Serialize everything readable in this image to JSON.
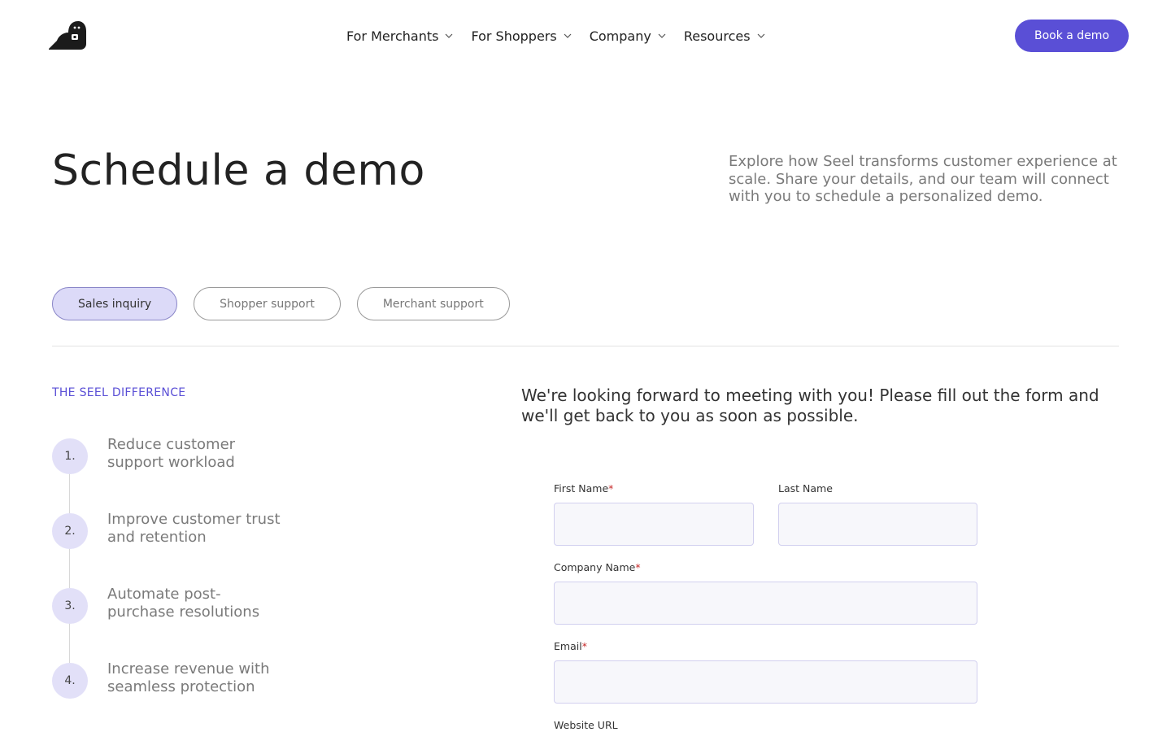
{
  "header": {
    "nav": [
      {
        "label": "For Merchants"
      },
      {
        "label": "For Shoppers"
      },
      {
        "label": "Company"
      },
      {
        "label": "Resources"
      }
    ],
    "cta_label": "Book a demo"
  },
  "hero": {
    "title": "Schedule a demo",
    "description": "Explore how Seel transforms customer experience at scale. Share your details, and our team will connect with you to schedule a personalized demo."
  },
  "tabs": [
    {
      "label": "Sales inquiry",
      "active": true
    },
    {
      "label": "Shopper support",
      "active": false
    },
    {
      "label": "Merchant support",
      "active": false
    }
  ],
  "difference": {
    "label": "THE SEEL DIFFERENCE",
    "steps": [
      {
        "num": "1.",
        "text": "Reduce customer support workload"
      },
      {
        "num": "2.",
        "text": "Improve customer trust and retention"
      },
      {
        "num": "3.",
        "text": "Automate post-purchase resolutions"
      },
      {
        "num": "4.",
        "text": "Increase revenue with seamless protection"
      }
    ]
  },
  "form": {
    "intro": "We're looking forward to meeting with you! Please fill out the form and we'll get back to you as soon as possible.",
    "required_mark": "*",
    "first_name": {
      "label": "First Name",
      "value": ""
    },
    "last_name": {
      "label": "Last Name",
      "value": ""
    },
    "company_name": {
      "label": "Company Name",
      "value": ""
    },
    "email": {
      "label": "Email",
      "value": ""
    },
    "website": {
      "label": "Website URL"
    }
  },
  "colors": {
    "accent": "#5a4fd6",
    "tab_active_bg": "#dcdaf8",
    "step_circle_bg": "#e2e0f8",
    "required": "#c62828"
  },
  "icons": {
    "logo": "seel-bird-logo",
    "nav_chevron": "chevron-down-icon"
  }
}
